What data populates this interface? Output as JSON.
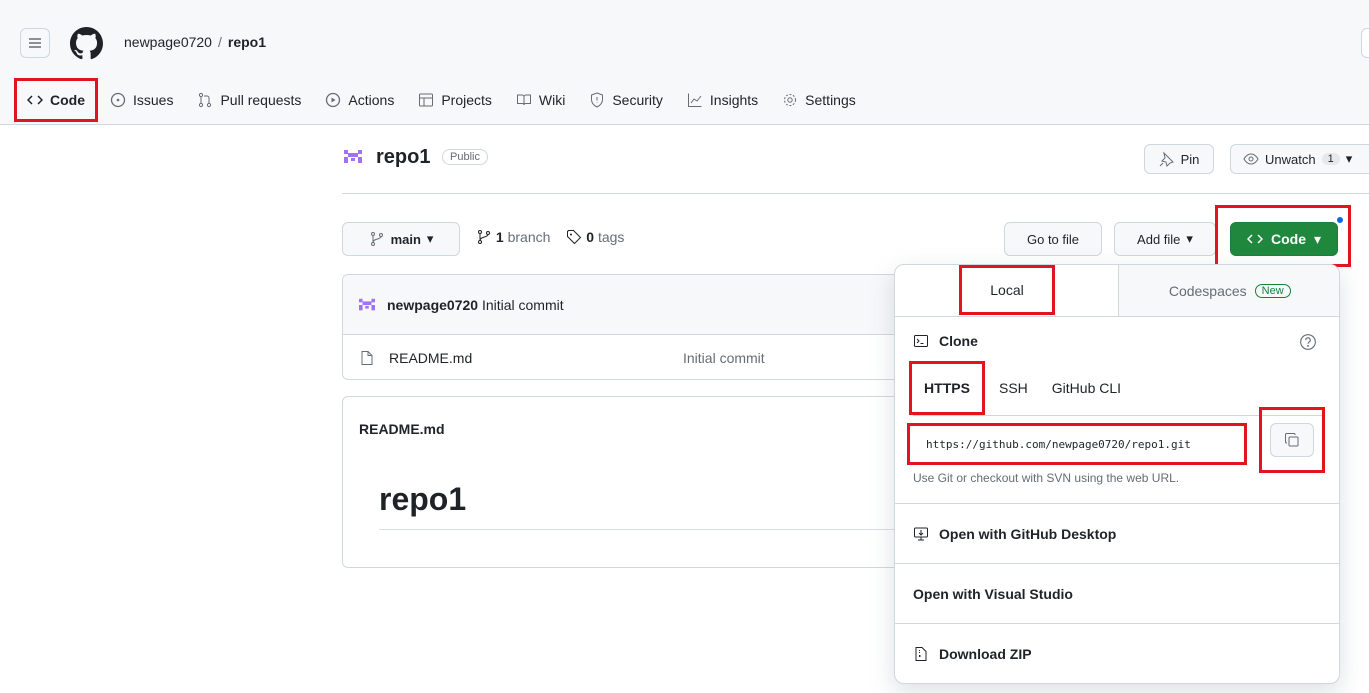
{
  "header": {
    "owner": "newpage0720",
    "separator": "/",
    "repo": "repo1"
  },
  "nav": {
    "items": [
      {
        "label": "Code",
        "icon": "code-icon"
      },
      {
        "label": "Issues",
        "icon": "issue-icon"
      },
      {
        "label": "Pull requests",
        "icon": "pull-request-icon"
      },
      {
        "label": "Actions",
        "icon": "play-icon"
      },
      {
        "label": "Projects",
        "icon": "table-icon"
      },
      {
        "label": "Wiki",
        "icon": "book-icon"
      },
      {
        "label": "Security",
        "icon": "shield-icon"
      },
      {
        "label": "Insights",
        "icon": "graph-icon"
      },
      {
        "label": "Settings",
        "icon": "gear-icon"
      }
    ]
  },
  "repo_header": {
    "name": "repo1",
    "visibility": "Public",
    "pin_label": "Pin",
    "watch_label": "Unwatch",
    "watch_count": "1"
  },
  "toolbar": {
    "branch_label": "main",
    "branch_count": "1",
    "branch_word": "branch",
    "tag_count": "0",
    "tag_word": "tags",
    "goto_file": "Go to file",
    "add_file": "Add file",
    "code_label": "Code"
  },
  "files": {
    "commit_author": "newpage0720",
    "commit_message": "Initial commit",
    "rows": [
      {
        "name": "README.md",
        "message": "Initial commit"
      }
    ]
  },
  "readme": {
    "title": "README.md",
    "heading": "repo1"
  },
  "clone_panel": {
    "tab_local": "Local",
    "tab_codespaces": "Codespaces",
    "new_badge": "New",
    "clone_title": "Clone",
    "protocols": [
      "HTTPS",
      "SSH",
      "GitHub CLI"
    ],
    "url": "https://github.com/newpage0720/repo1.git",
    "hint": "Use Git or checkout with SVN using the web URL.",
    "open_desktop": "Open with GitHub Desktop",
    "open_vs": "Open with Visual Studio",
    "download_zip": "Download ZIP"
  },
  "colors": {
    "accent_green": "#1f883d",
    "annotation_red": "#e2141e",
    "link_blue": "#0969da"
  }
}
